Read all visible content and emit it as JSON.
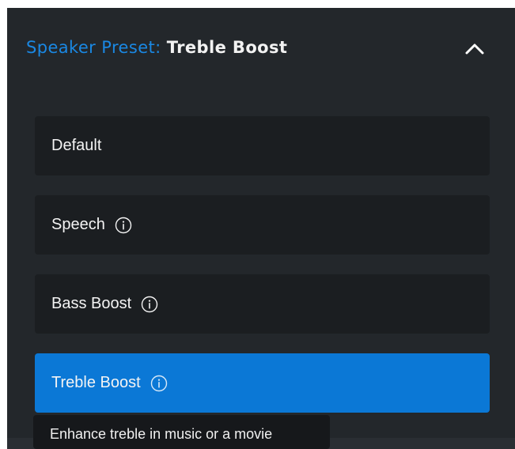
{
  "header": {
    "prefix": "Speaker Preset:",
    "value": "Treble Boost",
    "collapse_icon": "chevron-up-icon"
  },
  "options": [
    {
      "label": "Default",
      "has_info": false,
      "selected": false
    },
    {
      "label": "Speech",
      "has_info": true,
      "selected": false
    },
    {
      "label": "Bass Boost",
      "has_info": true,
      "selected": false
    },
    {
      "label": "Treble Boost",
      "has_info": true,
      "selected": true
    }
  ],
  "tooltip": {
    "text": "Enhance treble in music or a movie"
  },
  "colors": {
    "panel_background": "#23272b",
    "option_background": "#1b1e21",
    "selected_background": "#0b78d6",
    "accent": "#1a88e3",
    "tooltip_background": "#16181b",
    "text": "#f4f4f4"
  }
}
